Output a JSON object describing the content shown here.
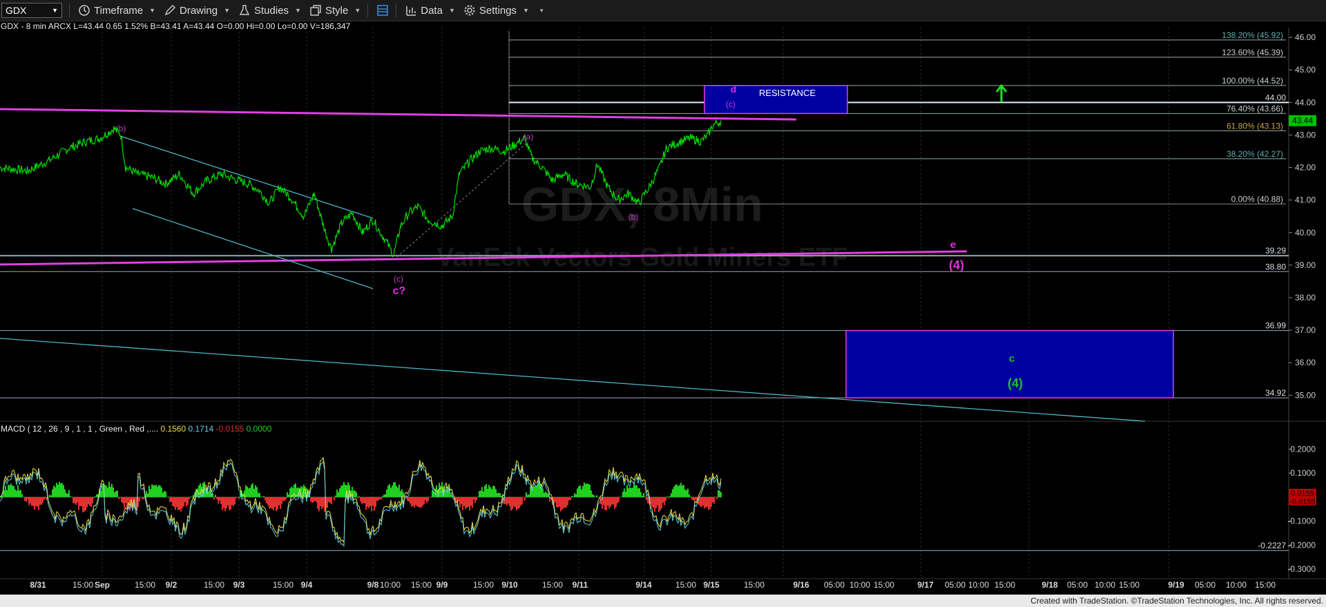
{
  "toolbar": {
    "symbol": "GDX",
    "timeframe": "Timeframe",
    "drawing": "Drawing",
    "studies": "Studies",
    "style": "Style",
    "data": "Data",
    "settings": "Settings"
  },
  "info": {
    "symbol": "GDX",
    "interval": "8 min",
    "exchange": "ARCX",
    "last": "L=43.44",
    "change": "0.65",
    "pct": "1.52%",
    "bid": "B=43.41",
    "ask": "A=43.44",
    "open": "O=0.00",
    "hi": "Hi=0.00",
    "lo": "Lo=0.00",
    "volume": "V=186,347"
  },
  "watermark": {
    "main": "GDX, 8Min",
    "sub": "VanEck Vectors Gold Miners ETF"
  },
  "chart_data": {
    "type": "line",
    "price_axis": {
      "ticks": [
        "46.00",
        "45.00",
        "44.00",
        "43.00",
        "42.00",
        "41.00",
        "40.00",
        "39.00",
        "38.00",
        "37.00",
        "36.00",
        "35.00"
      ],
      "ylim": [
        34.2,
        46.3
      ]
    },
    "last_price_tag": "43.44",
    "macd_axis": {
      "ticks": [
        "0.2000",
        "0.1000",
        "-0.1000",
        "-0.2000",
        "-0.3000"
      ],
      "ylim": [
        -0.34,
        0.27
      ]
    },
    "macd_tags": {
      "zero": "0.0155",
      "neg": "-0.0155",
      "low": "-0.2227"
    },
    "time_labels": [
      "8/31",
      "15:00",
      "Sep",
      "15:00",
      "9/2",
      "15:00",
      "9/3",
      "15:00",
      "9/4",
      "9/8",
      "10:00",
      "15:00",
      "9/9",
      "15:00",
      "9/10",
      "15:00",
      "9/11",
      "9/14",
      "15:00",
      "9/15",
      "15:00",
      "9/16",
      "05:00",
      "10:00",
      "15:00",
      "9/17",
      "05:00",
      "10:00",
      "15:00",
      "9/18",
      "05:00",
      "10:00",
      "15:00",
      "9/19",
      "05:00",
      "10:00",
      "15:00"
    ],
    "fib_levels": [
      {
        "label": "138.20% (45.92)",
        "price": 45.92
      },
      {
        "label": "123.60% (45.39)",
        "price": 45.39
      },
      {
        "label": "100.00% (44.52)",
        "price": 44.52
      },
      {
        "label": "76.40% (43.66)",
        "price": 43.66
      },
      {
        "label": "61.80% (43.13)",
        "price": 43.13
      },
      {
        "label": "38.20% (42.27)",
        "price": 42.27
      },
      {
        "label": "0.00% (40.88)",
        "price": 40.88
      }
    ],
    "horizontal_levels": [
      {
        "label": "44.00",
        "price": 44.0
      },
      {
        "label": "39.29",
        "price": 39.29
      },
      {
        "label": "38.80",
        "price": 38.8
      },
      {
        "label": "36.99",
        "price": 36.99
      },
      {
        "label": "34.92",
        "price": 34.92
      }
    ],
    "wave_labels": [
      {
        "text": "(b)",
        "color": "#c040c0"
      },
      {
        "text": "(a)",
        "color": "#c040c0"
      },
      {
        "text": "(b)",
        "color": "#c040c0"
      },
      {
        "text": "(c)",
        "color": "#c040c0"
      },
      {
        "text": "c?",
        "color": "#e030e0"
      },
      {
        "text": "d",
        "color": "#e030e0"
      },
      {
        "text": "(c)",
        "color": "#e030e0"
      },
      {
        "text": "e",
        "color": "#e030e0"
      },
      {
        "text": "(4)",
        "color": "#e030e0"
      },
      {
        "text": "c",
        "color": "#20c020"
      },
      {
        "text": "(4)",
        "color": "#20c020"
      }
    ],
    "resistance_label": "RESISTANCE",
    "series": [
      {
        "name": "GDX",
        "color": "#00e000"
      }
    ]
  },
  "macd": {
    "label": "MACD ( 12 , 26 , 9 , 1 , 1 , Green , Red ,....",
    "v1": "0.1560",
    "v2": "0.1714",
    "v3": "-0.0155",
    "v4": "0.0000",
    "c1": "#f0e040",
    "c2": "#60d0e0",
    "c3": "#e03030",
    "c4": "#20d020"
  },
  "footer": "Created with TradeStation. ©TradeStation Technologies, Inc. All rights reserved."
}
